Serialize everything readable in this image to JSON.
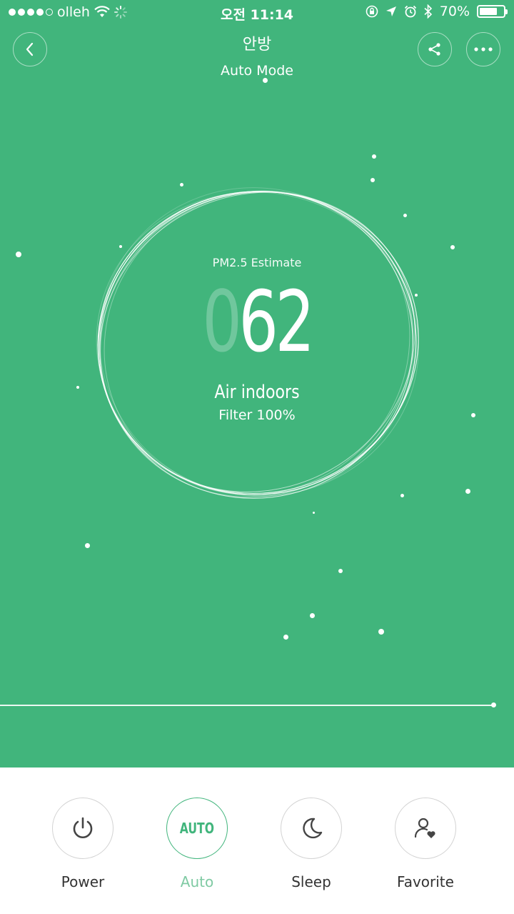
{
  "status_bar": {
    "carrier": "olleh",
    "time": "오전 11:14",
    "battery": "70%",
    "battery_level": 0.7
  },
  "header": {
    "title": "안방",
    "mode": "Auto Mode",
    "back_icon": "chevron-left-icon",
    "share_icon": "share-icon",
    "more_icon": "more-icon"
  },
  "readout": {
    "label": "PM2.5 Estimate",
    "leading_digit": "0",
    "value": "62",
    "air_label": "Air indoors",
    "filter": "Filter 100%"
  },
  "controls": [
    {
      "label": "Power",
      "icon": "power-icon",
      "active": false
    },
    {
      "label": "Auto",
      "icon_text": "AUTO",
      "active": true
    },
    {
      "label": "Sleep",
      "icon": "moon-icon",
      "active": false
    },
    {
      "label": "Favorite",
      "icon": "favorite-user-icon",
      "active": false
    }
  ],
  "colors": {
    "background": "#41b57c",
    "accent": "#41b57c",
    "active_label": "#7fcaa3",
    "panel": "#ffffff"
  }
}
